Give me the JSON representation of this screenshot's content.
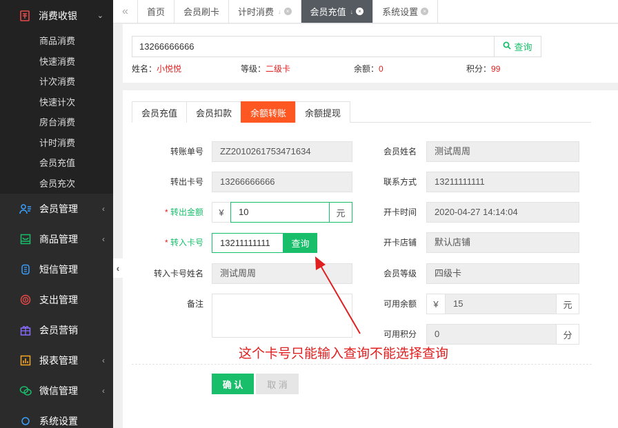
{
  "sidebar": {
    "open_group": {
      "label": "消费收银",
      "icon": "cashier-icon"
    },
    "sub_items": [
      "商品消费",
      "快速消费",
      "计次消费",
      "快速计次",
      "房台消费",
      "计时消费",
      "会员充值",
      "会员充次"
    ],
    "groups": [
      {
        "label": "会员管理",
        "icon": "members-icon",
        "arrow": true
      },
      {
        "label": "商品管理",
        "icon": "goods-icon",
        "arrow": true
      },
      {
        "label": "短信管理",
        "icon": "sms-icon",
        "arrow": false
      },
      {
        "label": "支出管理",
        "icon": "expense-icon",
        "arrow": false
      },
      {
        "label": "会员营销",
        "icon": "gift-icon",
        "arrow": false
      },
      {
        "label": "报表管理",
        "icon": "report-icon",
        "arrow": true
      },
      {
        "label": "微信管理",
        "icon": "wechat-icon",
        "arrow": true
      },
      {
        "label": "系统设置",
        "icon": "settings-icon",
        "arrow": false
      }
    ]
  },
  "tabs": {
    "items": [
      {
        "label": "首页",
        "pin": false,
        "close": false,
        "active": false
      },
      {
        "label": "会员刷卡",
        "pin": false,
        "close": false,
        "active": false
      },
      {
        "label": "计时消费",
        "pin": true,
        "close": true,
        "active": false
      },
      {
        "label": "会员充值",
        "pin": true,
        "close": true,
        "active": true
      },
      {
        "label": "系统设置",
        "pin": false,
        "close": true,
        "active": false
      }
    ]
  },
  "search": {
    "value": "13266666666",
    "button": "查询"
  },
  "member_info": {
    "name_label": "姓名：",
    "name": "小悦悦",
    "level_label": "等级：",
    "level": "二级卡",
    "balance_label": "余额：",
    "balance": "0",
    "points_label": "积分：",
    "points": "99"
  },
  "subtabs": [
    "会员充值",
    "会员扣款",
    "余额转账",
    "余额提现"
  ],
  "form": {
    "transfer_no_label": "转账单号",
    "transfer_no": "ZZ2010261753471634",
    "out_card_label": "转出卡号",
    "out_card": "13266666666",
    "amount_label": "转出金额",
    "amount_prefix": "¥",
    "amount": "10",
    "amount_suffix": "元",
    "in_card_label": "转入卡号",
    "in_card": "13211111111",
    "in_card_btn": "查询",
    "in_name_label": "转入卡号姓名",
    "in_name": "测试周周",
    "remark_label": "备注",
    "member_name_label": "会员姓名",
    "member_name": "测试周周",
    "contact_label": "联系方式",
    "contact": "13211111111",
    "open_time_label": "开卡时间",
    "open_time": "2020-04-27 14:14:04",
    "store_label": "开卡店铺",
    "store": "默认店铺",
    "level_label": "会员等级",
    "level": "四级卡",
    "avail_balance_label": "可用余额",
    "avail_prefix": "¥",
    "avail_balance": "15",
    "avail_suffix": "元",
    "avail_points_label": "可用积分",
    "avail_points": "0",
    "points_suffix": "分",
    "required_star": "*"
  },
  "buttons": {
    "confirm": "确 认",
    "cancel": "取 消"
  },
  "annotation": "这个卡号只能输入查询不能选择查询",
  "colors": {
    "green": "#19be6b",
    "orange": "#ff5722",
    "red": "#e02020",
    "sidebar": "#2b2b2b"
  }
}
